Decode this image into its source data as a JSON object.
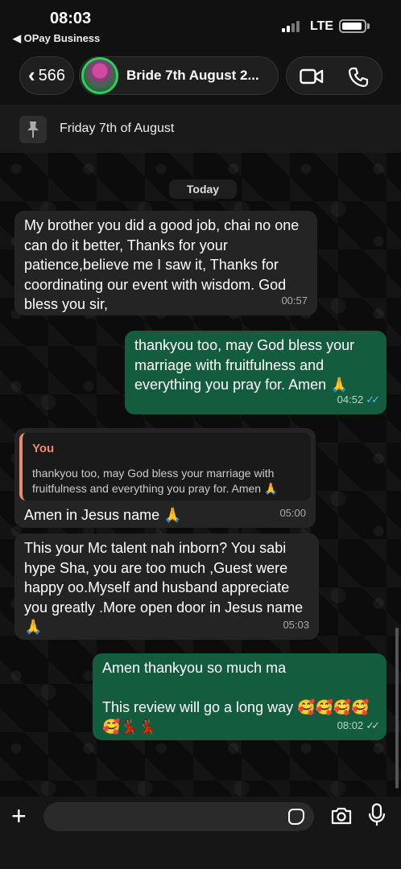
{
  "status_bar": {
    "time": "08:03",
    "back_app": "◀ OPay Business",
    "network": "LTE"
  },
  "header": {
    "back_count": "566",
    "chat_title": "Bride 7th August 2...",
    "video_icon": "video-camera-icon",
    "phone_icon": "phone-icon"
  },
  "pinned": {
    "icon": "pin-icon",
    "text": "Friday 7th of August"
  },
  "date_chip": "Today",
  "messages": [
    {
      "direction": "incoming",
      "text": "My brother you did a good job, chai no one can do it better, Thanks for your patience,believe me I saw it,  Thanks for coordinating our event with wisdom. God bless you sir,",
      "time": "00:57"
    },
    {
      "direction": "outgoing",
      "text": "thankyou too, may God bless your marriage with fruitfulness and everything you pray for.  Amen 🙏",
      "time": "04:52",
      "ticks": "✓✓"
    },
    {
      "direction": "incoming",
      "quote_author": "You",
      "quote_text": "thankyou too, may God bless your marriage with fruitfulness and everything you pray for.  Amen 🙏",
      "text": "Amen in Jesus name 🙏",
      "time": "05:00"
    },
    {
      "direction": "incoming",
      "text": "This your Mc talent nah inborn? You sabi hype Sha, you are too much ,Guest were happy oo.Myself and husband appreciate you greatly .More open door in Jesus name 🙏",
      "time": "05:03"
    },
    {
      "direction": "outgoing",
      "text_line1": "Amen thankyou so much ma",
      "text_line2": "This review will go a long way 🥰🥰🥰🥰🥰💃🏾💃🏾",
      "time": "08:02",
      "ticks": "✓✓"
    }
  ],
  "input_bar": {
    "plus_icon": "plus-icon",
    "sticker_icon": "sticker-icon",
    "camera_icon": "camera-icon",
    "mic_icon": "microphone-icon"
  },
  "colors": {
    "outgoing_bubble": "#135c3d",
    "incoming_bubble": "#242424",
    "read_ticks": "#5db4ff",
    "quote_accent": "#e98b6f",
    "avatar_ring": "#2bd05c"
  }
}
